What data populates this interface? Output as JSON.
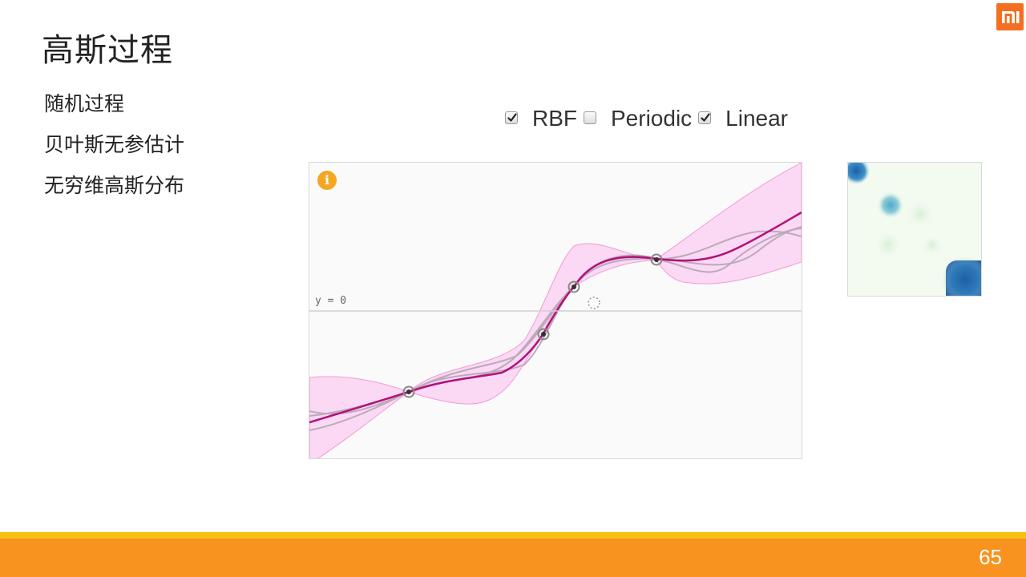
{
  "slide": {
    "title": "高斯过程",
    "bullets": [
      "随机过程",
      "贝叶斯无参估计",
      "无穷维高斯分布"
    ],
    "page_number": "65"
  },
  "kernels": [
    {
      "label": "RBF",
      "checked": true
    },
    {
      "label": "Periodic",
      "checked": false
    },
    {
      "label": "Linear",
      "checked": true
    }
  ],
  "plot": {
    "zero_label": "y = 0",
    "info_icon": "info-icon",
    "colors": {
      "mean": "#b0127a",
      "band": "#fbd3f2",
      "samples": "#b8a8b8",
      "accent": "#f5a623"
    }
  },
  "icons": {
    "logo": "mi-logo-icon",
    "loading": "loading-spinner-icon"
  },
  "colors": {
    "footer": "#f7931e",
    "footer_line": "#f5c10e",
    "logo": "#f36f21"
  }
}
